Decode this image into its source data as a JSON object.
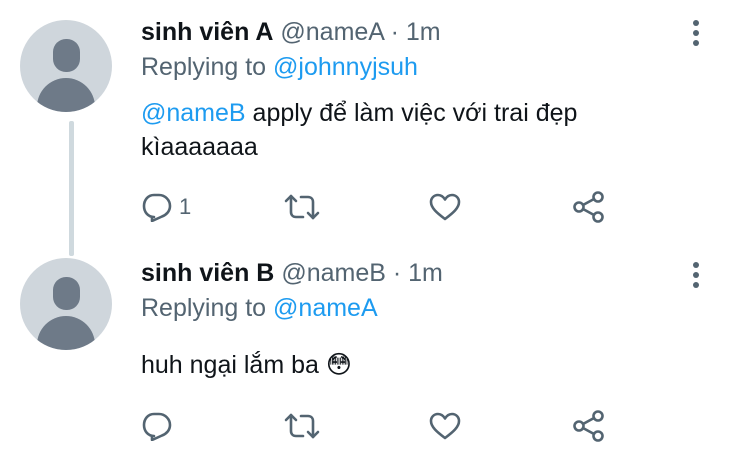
{
  "tweets": [
    {
      "name": "sinh viên A",
      "handle": "@nameA",
      "separator": "·",
      "time": "1m",
      "replying_prefix": "Replying to",
      "replying_to": "@johnnyjsuh",
      "mention": "@nameB",
      "text": " apply để làm việc với trai đẹp kìaaaaaaa",
      "reply_count": "1",
      "icons": [
        "avatar-placeholder",
        "more-vertical-icon",
        "reply-icon",
        "retweet-icon",
        "like-icon",
        "share-icon"
      ]
    },
    {
      "name": "sinh viên B",
      "handle": "@nameB",
      "separator": "·",
      "time": "1m",
      "replying_prefix": "Replying to",
      "replying_to": "@nameA",
      "text": "huh ngại lắm ba",
      "emoji": "😳",
      "icons": [
        "avatar-placeholder",
        "more-vertical-icon",
        "reply-icon",
        "retweet-icon",
        "like-icon",
        "share-icon"
      ]
    }
  ],
  "colors": {
    "link": "#1d9bf0",
    "secondary_text": "#536471",
    "primary_text": "#0f1419",
    "avatar_bg": "#cfd6dc",
    "avatar_figure": "#6e7a88",
    "thread_line": "#cfd9de"
  }
}
